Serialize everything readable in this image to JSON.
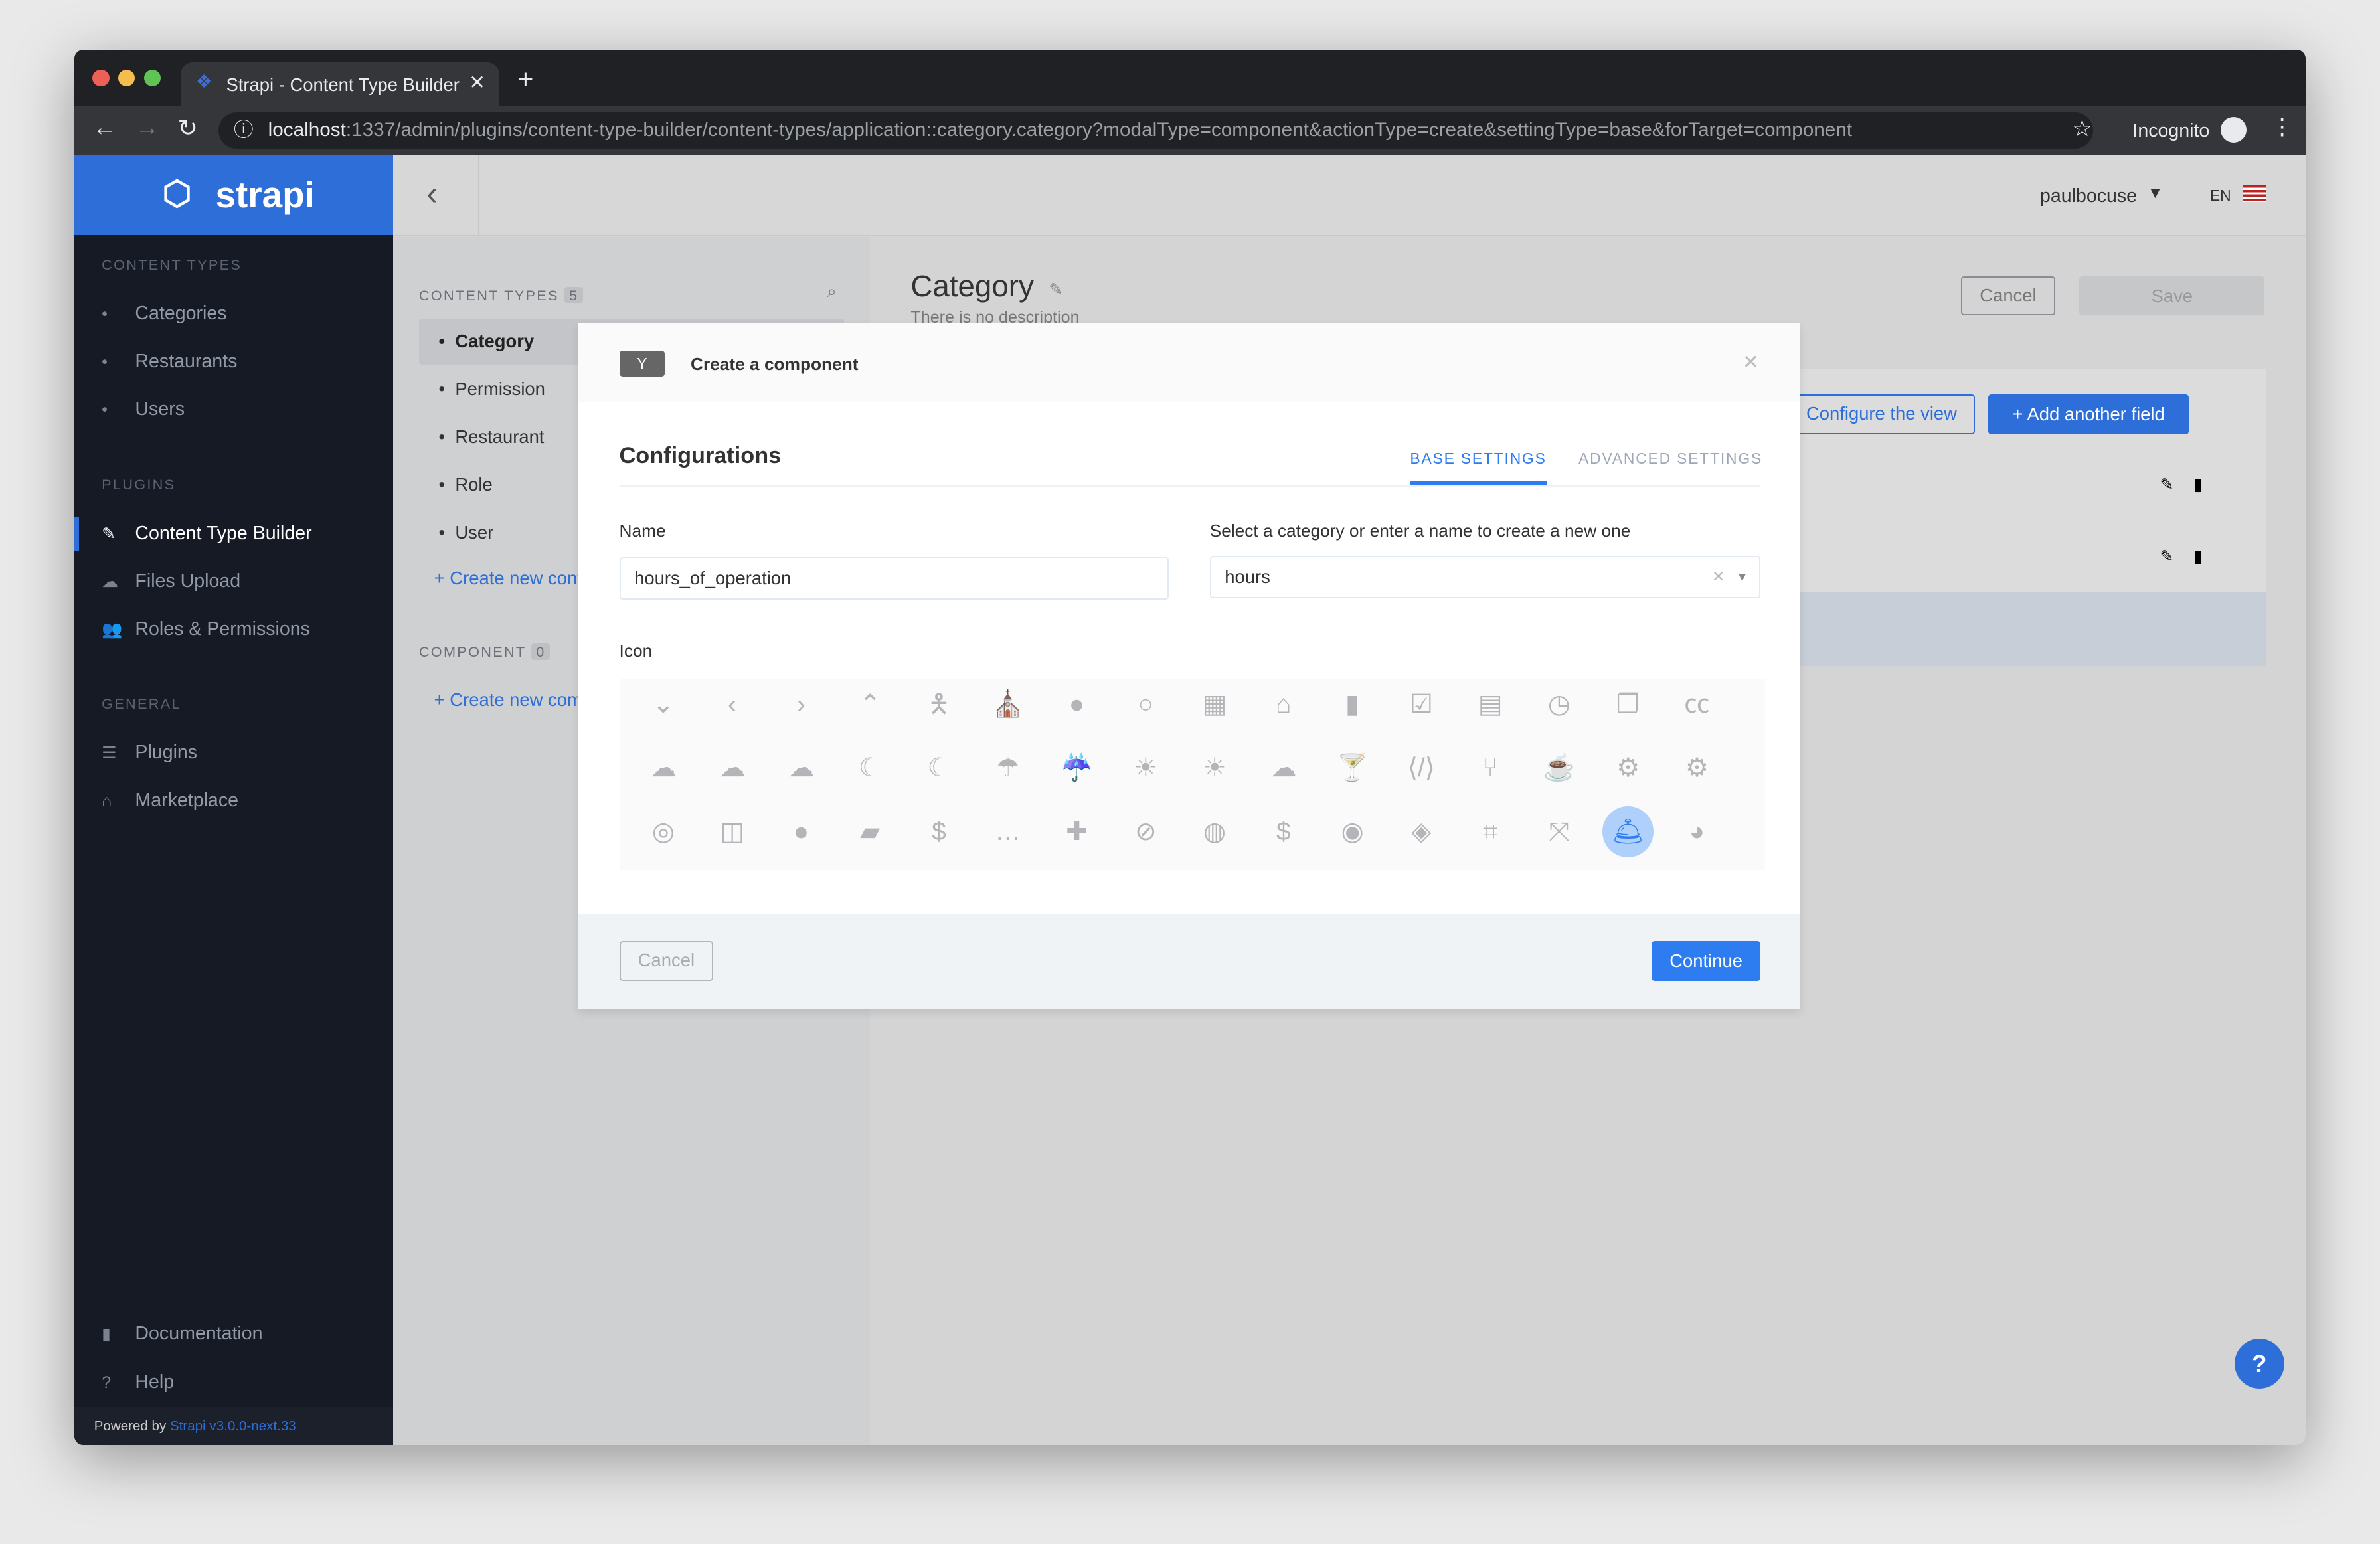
{
  "browser": {
    "tab_title": "Strapi - Content Type Builder",
    "url_host": "localhost",
    "url_rest": ":1337/admin/plugins/content-type-builder/content-types/application::category.category?modalType=component&actionType=create&settingType=base&forTarget=component",
    "profile": "Incognito"
  },
  "sidebar": {
    "logo": "strapi",
    "sections": [
      {
        "title": "CONTENT TYPES",
        "items": [
          {
            "label": "Categories",
            "icon": "bullet"
          },
          {
            "label": "Restaurants",
            "icon": "bullet"
          },
          {
            "label": "Users",
            "icon": "bullet"
          }
        ]
      },
      {
        "title": "PLUGINS",
        "items": [
          {
            "label": "Content Type Builder",
            "icon": "paintbrush-icon",
            "active": true
          },
          {
            "label": "Files Upload",
            "icon": "cloud-upload-icon"
          },
          {
            "label": "Roles & Permissions",
            "icon": "users-icon"
          }
        ]
      },
      {
        "title": "GENERAL",
        "items": [
          {
            "label": "Plugins",
            "icon": "list-icon"
          },
          {
            "label": "Marketplace",
            "icon": "shopping-basket-icon"
          }
        ]
      }
    ],
    "footer_items": [
      {
        "label": "Documentation",
        "icon": "book-icon"
      },
      {
        "label": "Help",
        "icon": "question-circle-icon"
      }
    ],
    "powered_by": "Powered by",
    "version": "Strapi v3.0.0-next.33"
  },
  "header": {
    "user": "paulbocuse",
    "lang": "EN"
  },
  "content_types_panel": {
    "title": "CONTENT TYPES",
    "count": "5",
    "items": [
      "Category",
      "Permission",
      "Restaurant",
      "Role",
      "User"
    ],
    "create_label": "Create new content type",
    "component_title": "COMPONENT",
    "component_count": "0",
    "create_component_label": "Create new component"
  },
  "main": {
    "title": "Category",
    "description": "There is no description",
    "cancel": "Cancel",
    "save": "Save",
    "configure_view": "Configure the view",
    "add_field": "Add another field"
  },
  "modal": {
    "title": "Create a component",
    "section": "Configurations",
    "tabs": [
      "BASE SETTINGS",
      "ADVANCED SETTINGS"
    ],
    "active_tab": 0,
    "name_label": "Name",
    "name_value": "hours_of_operation",
    "category_label": "Select a category or enter a name to create a new one",
    "category_value": "hours",
    "icon_label": "Icon",
    "selected_icon": "concierge-bell",
    "icons": [
      [
        "chevron-down",
        "chevron-left",
        "chevron-right",
        "chevron-up",
        "child",
        "church",
        "circle",
        "circle-notch",
        "city",
        "clinic-medical",
        "clipboard",
        "clipboard-check",
        "clipboard-list",
        "clock",
        "clone",
        "closed-captioning"
      ],
      [
        "cloud",
        "cloud-download-alt",
        "cloud-meatball",
        "cloud-moon",
        "cloud-moon-rain",
        "cloud-rain",
        "cloud-showers-heavy",
        "cloud-sun",
        "cloud-sun-rain",
        "cloud-upload-alt",
        "cocktail",
        "code",
        "code-branch",
        "coffee",
        "cog",
        "cogs"
      ],
      [
        "coins",
        "columns",
        "comment",
        "comment-alt",
        "comment-dollar",
        "comment-dots",
        "comment-medical",
        "comment-slash",
        "comments",
        "comments-dollar",
        "compact-disc",
        "compass",
        "compress",
        "compress-arrows-alt",
        "concierge-bell",
        "cookie"
      ]
    ],
    "cancel": "Cancel",
    "continue": "Continue"
  },
  "colors": {
    "brand": "#2d6ed8",
    "accent": "#2d7cf0",
    "sidebar": "#151a25"
  }
}
